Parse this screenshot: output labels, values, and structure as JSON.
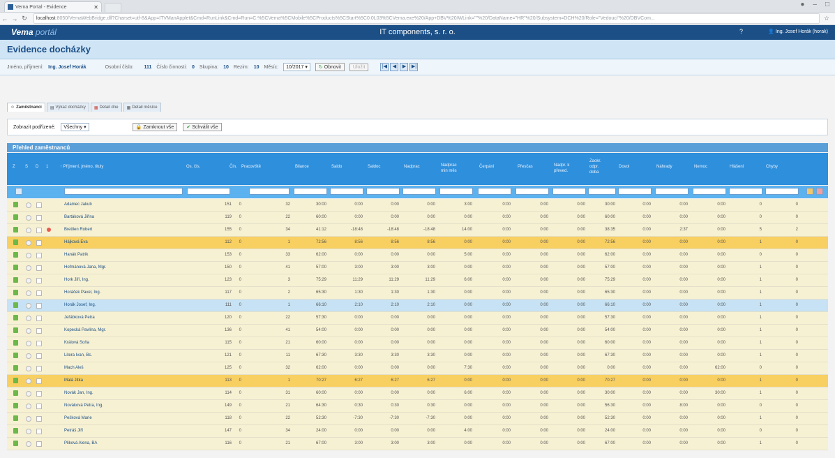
{
  "browser": {
    "tab_title": "Verna Portal - Evidence",
    "url_host": "localhost",
    "url_path": ":8050/VemaWebBridge.dll?Charset=utf-8&App=ITVManApplet&Cmd=RunLink&Cmd=Run=C:%5CVema%5CMobile%5CProducts%5CStart%5C0.0L03%5CVema.exe%20/App+DBV%20/WLink=\"\"%20/DataName=\"HR\"%20/Subsystem=DCH%20/Role=\"Vedouci\"%20/DBVCom..."
  },
  "app": {
    "logo_main": "Vema",
    "logo_sub": "portál",
    "company": "IT components, s. r. o.",
    "help": "?",
    "user": "Ing. Josef Horák (horak)"
  },
  "page": {
    "title": "Evidence docházky"
  },
  "filters": {
    "name_label": "Jméno, příjmení:",
    "name_value": "Ing. Josef Horák",
    "personal_label": "Osobní číslo:",
    "personal_value": "111",
    "activity_label": "Číslo činnosti:",
    "activity_value": "0",
    "group_label": "Skupina:",
    "group_value": "10",
    "mode_label": "Rezim:",
    "mode_value": "10",
    "month_label": "Měsíc:",
    "month_value": "10/2017",
    "refresh": "Obnovit",
    "close": "Uložit"
  },
  "subtabs": [
    "Zaměstnanci",
    "Výkaz docházky",
    "Detail dne",
    "Detail měsíce"
  ],
  "panel": {
    "subordinates_label": "Zobrazit podřízené:",
    "subordinates_value": "Všechny",
    "lock_all": "Zamknout vše",
    "approve_all": "Schválit vše"
  },
  "grid": {
    "title": "Přehled zaměstnanců",
    "headers": {
      "z": "Z",
      "s": "S",
      "d": "D",
      "num": "1",
      "name": "↑ Příjmení, jméno, tituly",
      "oscis": "Os. čís.",
      "cin": "Čin.",
      "pracoviste": "Pracoviště",
      "bilance": "Bilance",
      "saldo": "Saldo",
      "saldoc": "Saldoc",
      "nadprac": "Nadprac",
      "nadpmes": "Nadprac\nmin měs",
      "cerpani": "Čerpání",
      "prescas": "Přesčas",
      "nadprp": "Nadpr. k\npřeved.",
      "zaoklodpr": "Zaokr.\nodpr.\ndoba",
      "dovol": "Dovol",
      "nahrady": "Náhrady",
      "nemoc": "Nemoc",
      "hlaseni": "Hlášení",
      "chyby": "Chyby"
    },
    "rows": [
      {
        "name": "Adamec Jakub",
        "os": "151",
        "cin": "0",
        "pr": "32",
        "bil": "30:00",
        "sal": "0:00",
        "salc": "0:00",
        "np": "0:00",
        "npm": "3:00",
        "cer": "0:00",
        "pre": "0:00",
        "npp": "0:00",
        "zao": "30:00",
        "dov": "0:00",
        "nah": "0:00",
        "nem": "0:00",
        "hl": "0",
        "ch": "0",
        "style": "norm"
      },
      {
        "name": "Bartáková Jiřina",
        "os": "119",
        "cin": "0",
        "pr": "22",
        "bil": "60:00",
        "sal": "0:00",
        "salc": "0:00",
        "np": "0:00",
        "npm": "0:00",
        "cer": "0:00",
        "pre": "0:00",
        "npp": "0:00",
        "zao": "60:00",
        "dov": "0:00",
        "nah": "0:00",
        "nem": "0:00",
        "hl": "0",
        "ch": "0",
        "style": "norm"
      },
      {
        "name": "Brettlen Robert",
        "os": "155",
        "cin": "0",
        "pr": "34",
        "bil": "41:12",
        "sal": "-18:48",
        "salc": "-18:48",
        "np": "-18:48",
        "npm": "14:00",
        "cer": "0:00",
        "pre": "0:00",
        "npp": "0:00",
        "zao": "38:35",
        "dov": "0:00",
        "nah": "2:37",
        "nem": "0:00",
        "hl": "5",
        "ch": "2",
        "style": "norm",
        "mark": true
      },
      {
        "name": "Hájková Eva",
        "os": "112",
        "cin": "0",
        "pr": "1",
        "bil": "72:56",
        "sal": "8:56",
        "salc": "8:56",
        "np": "8:56",
        "npm": "0:00",
        "cer": "0:00",
        "pre": "0:00",
        "npp": "0:00",
        "zao": "72:56",
        "dov": "0:00",
        "nah": "0:00",
        "nem": "0:00",
        "hl": "1",
        "ch": "0",
        "style": "sel-o"
      },
      {
        "name": "Hanák Patrik",
        "os": "153",
        "cin": "0",
        "pr": "33",
        "bil": "62:00",
        "sal": "0:00",
        "salc": "0:00",
        "np": "0:00",
        "npm": "5:00",
        "cer": "0:00",
        "pre": "0:00",
        "npp": "0:00",
        "zao": "62:00",
        "dov": "0:00",
        "nah": "0:00",
        "nem": "0:00",
        "hl": "0",
        "ch": "0",
        "style": "norm"
      },
      {
        "name": "Hofmánová Jana, Mgr.",
        "os": "150",
        "cin": "0",
        "pr": "41",
        "bil": "57:00",
        "sal": "3:00",
        "salc": "3:00",
        "np": "3:00",
        "npm": "0:00",
        "cer": "0:00",
        "pre": "0:00",
        "npp": "0:00",
        "zao": "57:00",
        "dov": "0:00",
        "nah": "0:00",
        "nem": "0:00",
        "hl": "1",
        "ch": "0",
        "style": "norm"
      },
      {
        "name": "Hork Jiří, Ing.",
        "os": "123",
        "cin": "0",
        "pr": "3",
        "bil": "75:29",
        "sal": "11:29",
        "salc": "11:29",
        "np": "11:29",
        "npm": "6:00",
        "cer": "0:00",
        "pre": "0:00",
        "npp": "0:00",
        "zao": "75:29",
        "dov": "0:00",
        "nah": "0:00",
        "nem": "0:00",
        "hl": "1",
        "ch": "0",
        "style": "norm"
      },
      {
        "name": "Horáček Pavel, Ing.",
        "os": "117",
        "cin": "0",
        "pr": "2",
        "bil": "65:30",
        "sal": "1:30",
        "salc": "1:30",
        "np": "1:30",
        "npm": "0:00",
        "cer": "0:00",
        "pre": "0:00",
        "npp": "0:00",
        "zao": "65:30",
        "dov": "0:00",
        "nah": "0:00",
        "nem": "0:00",
        "hl": "1",
        "ch": "0",
        "style": "norm"
      },
      {
        "name": "Horák Josef, Ing.",
        "os": "111",
        "cin": "0",
        "pr": "1",
        "bil": "66:10",
        "sal": "2:10",
        "salc": "2:10",
        "np": "2:10",
        "npm": "0:00",
        "cer": "0:00",
        "pre": "0:00",
        "npp": "0:00",
        "zao": "66:10",
        "dov": "0:00",
        "nah": "0:00",
        "nem": "0:00",
        "hl": "1",
        "ch": "0",
        "style": "sel-b"
      },
      {
        "name": "Jeřábková Petra",
        "os": "120",
        "cin": "0",
        "pr": "22",
        "bil": "57:30",
        "sal": "0:00",
        "salc": "0:00",
        "np": "0:00",
        "npm": "0:00",
        "cer": "0:00",
        "pre": "0:00",
        "npp": "0:00",
        "zao": "57:30",
        "dov": "0:00",
        "nah": "0:00",
        "nem": "0:00",
        "hl": "1",
        "ch": "0",
        "style": "norm"
      },
      {
        "name": "Kopecká Pavlína, Mgr.",
        "os": "136",
        "cin": "0",
        "pr": "41",
        "bil": "54:00",
        "sal": "0:00",
        "salc": "0:00",
        "np": "0:00",
        "npm": "0:00",
        "cer": "0:00",
        "pre": "0:00",
        "npp": "0:00",
        "zao": "54:00",
        "dov": "0:00",
        "nah": "0:00",
        "nem": "0:00",
        "hl": "1",
        "ch": "0",
        "style": "norm"
      },
      {
        "name": "Králová Soňa",
        "os": "115",
        "cin": "0",
        "pr": "21",
        "bil": "60:00",
        "sal": "0:00",
        "salc": "0:00",
        "np": "0:00",
        "npm": "0:00",
        "cer": "0:00",
        "pre": "0:00",
        "npp": "0:00",
        "zao": "60:00",
        "dov": "0:00",
        "nah": "0:00",
        "nem": "0:00",
        "hl": "1",
        "ch": "0",
        "style": "norm"
      },
      {
        "name": "Litera Ivan, Bc.",
        "os": "121",
        "cin": "0",
        "pr": "11",
        "bil": "67:30",
        "sal": "3:30",
        "salc": "3:30",
        "np": "3:30",
        "npm": "0:00",
        "cer": "0:00",
        "pre": "0:00",
        "npp": "0:00",
        "zao": "67:30",
        "dov": "0:00",
        "nah": "0:00",
        "nem": "0:00",
        "hl": "1",
        "ch": "0",
        "style": "norm"
      },
      {
        "name": "Mach Aleš",
        "os": "125",
        "cin": "0",
        "pr": "32",
        "bil": "62:00",
        "sal": "0:00",
        "salc": "0:00",
        "np": "0:00",
        "npm": "7:30",
        "cer": "0:00",
        "pre": "0:00",
        "npp": "0:00",
        "zao": "0:00",
        "dov": "0:00",
        "nah": "0:00",
        "nem": "62:00",
        "hl": "0",
        "ch": "0",
        "style": "norm"
      },
      {
        "name": "Malá Jitka",
        "os": "113",
        "cin": "0",
        "pr": "1",
        "bil": "70:27",
        "sal": "6:27",
        "salc": "6:27",
        "np": "6:27",
        "npm": "0:00",
        "cer": "0:00",
        "pre": "0:00",
        "npp": "0:00",
        "zao": "70:27",
        "dov": "0:00",
        "nah": "0:00",
        "nem": "0:00",
        "hl": "1",
        "ch": "0",
        "style": "sel-o"
      },
      {
        "name": "Novák Jan, Ing.",
        "os": "114",
        "cin": "0",
        "pr": "31",
        "bil": "60:00",
        "sal": "0:00",
        "salc": "0:00",
        "np": "0:00",
        "npm": "6:00",
        "cer": "0:00",
        "pre": "0:00",
        "npp": "0:00",
        "zao": "30:00",
        "dov": "0:00",
        "nah": "0:00",
        "nem": "30:00",
        "hl": "1",
        "ch": "0",
        "style": "norm"
      },
      {
        "name": "Nováková Petra, Ing.",
        "os": "149",
        "cin": "0",
        "pr": "21",
        "bil": "64:30",
        "sal": "0:30",
        "salc": "0:30",
        "np": "0:30",
        "npm": "0:00",
        "cer": "0:00",
        "pre": "0:00",
        "npp": "0:00",
        "zao": "56:30",
        "dov": "0:00",
        "nah": "8:00",
        "nem": "0:00",
        "hl": "0",
        "ch": "0",
        "style": "norm"
      },
      {
        "name": "Pešková Marie",
        "os": "118",
        "cin": "0",
        "pr": "22",
        "bil": "52:30",
        "sal": "-7:30",
        "salc": "-7:30",
        "np": "-7:30",
        "npm": "0:00",
        "cer": "0:00",
        "pre": "0:00",
        "npp": "0:00",
        "zao": "52:30",
        "dov": "0:00",
        "nah": "0:00",
        "nem": "0:00",
        "hl": "1",
        "ch": "0",
        "style": "norm"
      },
      {
        "name": "Petráš Jiří",
        "os": "147",
        "cin": "0",
        "pr": "34",
        "bil": "24:00",
        "sal": "0:00",
        "salc": "0:00",
        "np": "0:00",
        "npm": "4:00",
        "cer": "0:00",
        "pre": "0:00",
        "npp": "0:00",
        "zao": "24:00",
        "dov": "0:00",
        "nah": "0:00",
        "nem": "0:00",
        "hl": "0",
        "ch": "0",
        "style": "norm"
      },
      {
        "name": "Pliková Alena, BA",
        "os": "116",
        "cin": "0",
        "pr": "21",
        "bil": "67:00",
        "sal": "3:00",
        "salc": "3:00",
        "np": "3:00",
        "npm": "0:00",
        "cer": "0:00",
        "pre": "0:00",
        "npp": "0:00",
        "zao": "67:00",
        "dov": "0:00",
        "nah": "0:00",
        "nem": "0:00",
        "hl": "1",
        "ch": "0",
        "style": "norm"
      }
    ]
  }
}
